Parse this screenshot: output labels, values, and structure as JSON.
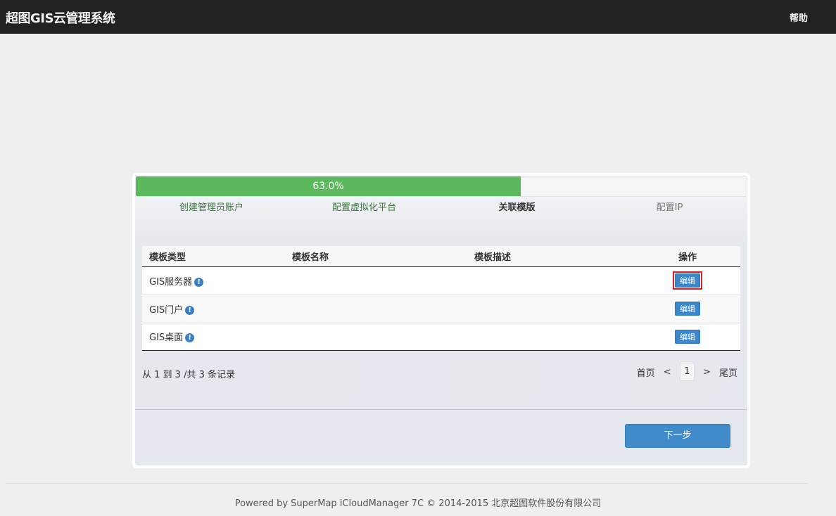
{
  "header": {
    "brand": "超图GIS云管理系统",
    "help": "帮助"
  },
  "wizard": {
    "progress": {
      "percent": 63.0,
      "label": "63.0%"
    },
    "steps": [
      {
        "label": "创建管理员账户",
        "state": "done"
      },
      {
        "label": "配置虚拟化平台",
        "state": "done"
      },
      {
        "label": "关联模版",
        "state": "active"
      },
      {
        "label": "配置IP",
        "state": "todo"
      }
    ],
    "table": {
      "columns": [
        "模板类型",
        "模板名称",
        "模板描述",
        "操作"
      ],
      "rows": [
        {
          "type": "GIS服务器",
          "name": "",
          "desc": "",
          "action": "编辑",
          "highlight": true
        },
        {
          "type": "GIS门户",
          "name": "",
          "desc": "",
          "action": "编辑",
          "highlight": false
        },
        {
          "type": "GIS桌面",
          "name": "",
          "desc": "",
          "action": "编辑",
          "highlight": false
        }
      ],
      "info_glyph": "!"
    },
    "records": "从 1 到 3 /共 3 条记录",
    "pager": {
      "first": "首页",
      "prev": "<",
      "current": "1",
      "next": ">",
      "last": "尾页"
    },
    "next_button": "下一步"
  },
  "footer": "Powered by SuperMap iCloudManager 7C © 2014-2015 北京超图软件股份有限公司",
  "colors": {
    "topbar": "#222222",
    "progress": "#5cb85c",
    "primary": "#428bca",
    "done_step": "#3c763d",
    "highlight": "#e02020"
  }
}
